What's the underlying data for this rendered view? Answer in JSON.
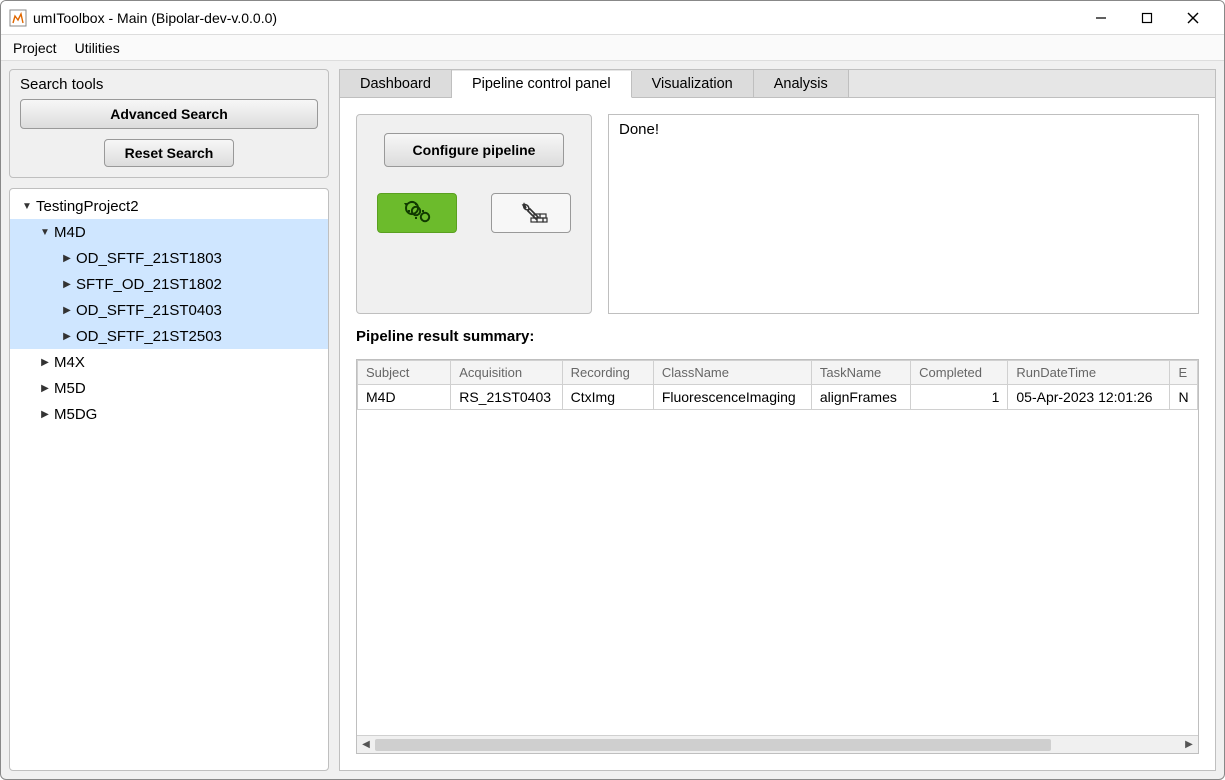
{
  "window": {
    "title": "umIToolbox - Main  (Bipolar-dev-v.0.0.0)"
  },
  "menu": {
    "project": "Project",
    "utilities": "Utilities"
  },
  "search": {
    "title": "Search tools",
    "advanced": "Advanced Search",
    "reset": "Reset Search"
  },
  "tree": {
    "root": "TestingProject2",
    "rootExpanded": true,
    "items": [
      {
        "label": "M4D",
        "expanded": true,
        "selected": true,
        "children": [
          {
            "label": "OD_SFTF_21ST1803",
            "selected": true
          },
          {
            "label": "SFTF_OD_21ST1802",
            "selected": true
          },
          {
            "label": "OD_SFTF_21ST0403",
            "selected": true
          },
          {
            "label": "OD_SFTF_21ST2503",
            "selected": true
          }
        ]
      },
      {
        "label": "M4X",
        "expanded": false
      },
      {
        "label": "M5D",
        "expanded": false
      },
      {
        "label": "M5DG",
        "expanded": false
      }
    ]
  },
  "tabs": {
    "dashboard": "Dashboard",
    "pipeline": "Pipeline control panel",
    "visualization": "Visualization",
    "analysis": "Analysis",
    "active": "pipeline"
  },
  "pipeline": {
    "configure": "Configure pipeline",
    "log": "Done!"
  },
  "summary": {
    "label": "Pipeline result summary:",
    "headers": [
      "Subject",
      "Acquisition",
      "Recording",
      "ClassName",
      "TaskName",
      "Completed",
      "RunDateTime",
      "E"
    ],
    "rows": [
      {
        "Subject": "M4D",
        "Acquisition": "RS_21ST0403",
        "Recording": "CtxImg",
        "ClassName": "FluorescenceImaging",
        "TaskName": "alignFrames",
        "Completed": "1",
        "RunDateTime": "05-Apr-2023 12:01:26",
        "E": "N"
      }
    ]
  }
}
